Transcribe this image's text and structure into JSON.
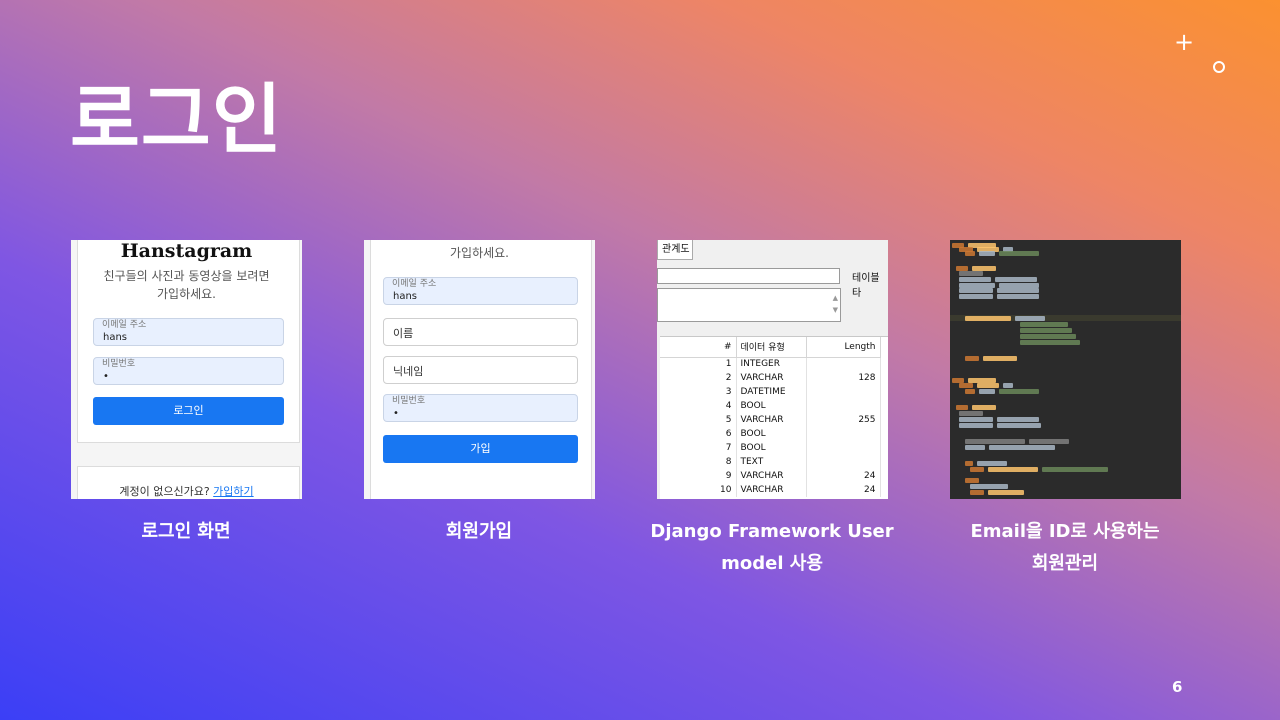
{
  "slide": {
    "title": "로그인",
    "page_number": "6",
    "deco_plus": "+"
  },
  "cards": [
    {
      "caption_lines": [
        "로그인 화면"
      ],
      "logo": "Hanstagram",
      "subtitle_1": "친구들의 사진과 동영상을 보려면",
      "subtitle_2": "가입하세요.",
      "email_label": "이메일 주소",
      "email_value": "hans",
      "password_label": "비밀번호",
      "password_value": "•",
      "login_button": "로그인",
      "signup_prompt": "계정이 없으신가요?",
      "signup_link": "가입하기"
    },
    {
      "caption_lines": [
        "회원가입"
      ],
      "subtitle": "가입하세요.",
      "email_label": "이메일 주소",
      "email_value": "hans",
      "name_placeholder": "이름",
      "nickname_placeholder": "닉네임",
      "password_label": "비밀번호",
      "password_value": "•",
      "join_button": "가입"
    },
    {
      "caption_lines": [
        "Django Framework User",
        "model 사용"
      ],
      "tab_label": "관계도",
      "field_label": "테이블 타",
      "columns": [
        "#",
        "데이터 유형",
        "Length"
      ],
      "rows": [
        {
          "num": "1",
          "type": "INTEGER",
          "len": ""
        },
        {
          "num": "2",
          "type": "VARCHAR",
          "len": "128"
        },
        {
          "num": "3",
          "type": "DATETIME",
          "len": ""
        },
        {
          "num": "4",
          "type": "BOOL",
          "len": ""
        },
        {
          "num": "5",
          "type": "VARCHAR",
          "len": "255"
        },
        {
          "num": "6",
          "type": "BOOL",
          "len": ""
        },
        {
          "num": "7",
          "type": "BOOL",
          "len": ""
        },
        {
          "num": "8",
          "type": "TEXT",
          "len": ""
        },
        {
          "num": "9",
          "type": "VARCHAR",
          "len": "24"
        },
        {
          "num": "10",
          "type": "VARCHAR",
          "len": "24"
        }
      ]
    },
    {
      "caption_lines": [
        "Email을 ID로 사용하는",
        "회원관리"
      ],
      "code_colors": {
        "keyword": "#cc7832",
        "string": "#6a8759",
        "name": "#ffc66d",
        "text": "#a9b7c6",
        "comment": "#808080"
      }
    }
  ]
}
